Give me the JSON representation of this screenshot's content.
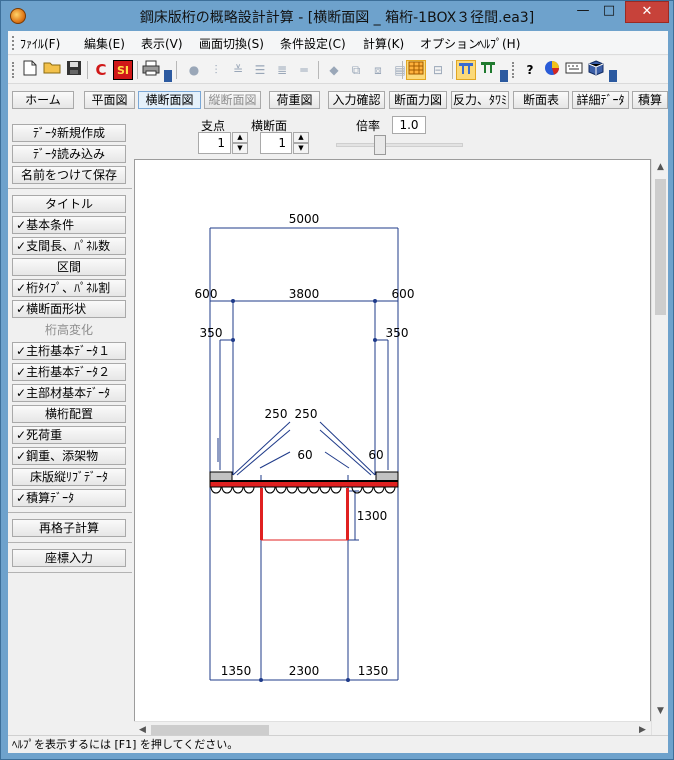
{
  "window": {
    "title": "鋼床版桁の概略設計計算 - [横断面図 _ 箱桁-1BOX３径間.ea3]",
    "min_glyph": "—",
    "max_glyph": "□",
    "close_glyph": "✕"
  },
  "menu": {
    "items": [
      "ﾌｧｲﾙ(F)",
      "編集(E)",
      "表示(V)",
      "画面切換(S)",
      "条件設定(C)",
      "計算(K)",
      "オプション",
      "ﾍﾙﾌﾟ(H)"
    ]
  },
  "toolbar": {
    "new_glyph": "🗋",
    "open_glyph": "📂",
    "save_glyph": "💾",
    "calc_c_label": "C",
    "calc_si_label": "SI",
    "print_glyph": "🖨",
    "help_glyph": "?"
  },
  "nav": {
    "buttons": [
      "ホーム",
      "平面図",
      "横断面図",
      "縦断面図",
      "荷重図",
      "入力確認",
      "断面力図",
      "反力、ﾀﾜﾐ",
      "断面表",
      "詳細ﾃﾞｰﾀ",
      "積算"
    ]
  },
  "side": {
    "buttons": [
      {
        "label": "ﾃﾞｰﾀ新規作成",
        "checked": false
      },
      {
        "label": "ﾃﾞｰﾀ読み込み",
        "checked": false
      },
      {
        "label": "名前をつけて保存",
        "checked": false
      },
      {
        "label": "タイトル",
        "checked": false
      },
      {
        "label": "基本条件",
        "checked": true
      },
      {
        "label": "支間長、ﾊﾟﾈﾙ数",
        "checked": true
      },
      {
        "label": "区間",
        "checked": false
      },
      {
        "label": "桁ﾀｲﾌﾟ、ﾊﾟﾈﾙ割",
        "checked": true
      },
      {
        "label": "横断面形状",
        "checked": true
      },
      {
        "label": "桁高変化",
        "checked": false
      },
      {
        "label": "主桁基本ﾃﾞｰﾀ１",
        "checked": true
      },
      {
        "label": "主桁基本ﾃﾞｰﾀ２",
        "checked": true
      },
      {
        "label": "主部材基本ﾃﾞｰﾀ",
        "checked": true
      },
      {
        "label": "横桁配置",
        "checked": false
      },
      {
        "label": "死荷重",
        "checked": true
      },
      {
        "label": "鋼重、添架物",
        "checked": true
      },
      {
        "label": "床版縦ﾘﾌﾞﾃﾞｰﾀ",
        "checked": false
      },
      {
        "label": "積算ﾃﾞｰﾀ",
        "checked": true
      },
      {
        "label": "再格子計算",
        "checked": false
      },
      {
        "label": "座標入力",
        "checked": false
      }
    ],
    "check_glyph": "✓"
  },
  "controls": {
    "support_label": "支点",
    "support_value": "1",
    "section_label": "横断面",
    "section_value": "1",
    "zoom_label": "倍率",
    "zoom_value": "1.0",
    "up_glyph": "▲",
    "down_glyph": "▼"
  },
  "drawing": {
    "dim_total_width": "5000",
    "dim_left_overhang": "600",
    "dim_top_inner": "3800",
    "dim_right_overhang": "600",
    "dim_left_350": "350",
    "dim_right_350": "350",
    "dim_left_250": "250",
    "dim_right_250": "250",
    "dim_left_60": "60",
    "dim_right_60": "60",
    "dim_web_height": "1300",
    "dim_bottom_left": "1350",
    "dim_bottom_center": "2300",
    "dim_bottom_right": "1350"
  },
  "scroll": {
    "up_glyph": "▲",
    "down_glyph": "▼",
    "left_glyph": "◀",
    "right_glyph": "▶"
  },
  "status": {
    "text": "ﾍﾙﾌﾟを表示するには [F1] を押してください。"
  },
  "colors": {
    "accent_red": "#e02020",
    "dim_blue": "#1f3b8a",
    "titlebar": "#6ea2cc"
  }
}
